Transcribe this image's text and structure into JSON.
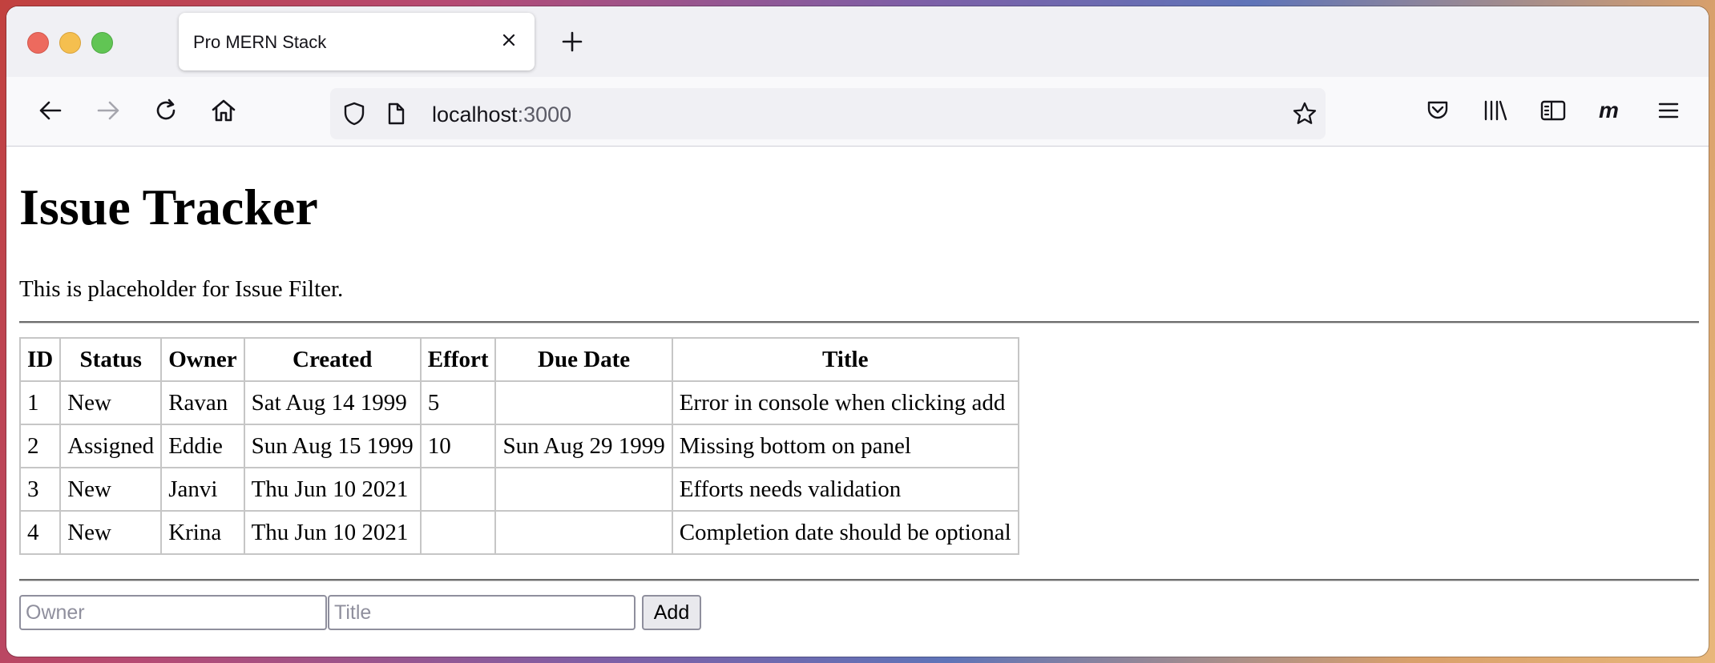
{
  "browser": {
    "tab_title": "Pro MERN Stack",
    "url_host": "localhost",
    "url_port": ":3000"
  },
  "page": {
    "title": "Issue Tracker",
    "filter_placeholder_text": "This is placeholder for Issue Filter.",
    "table": {
      "headers": [
        "ID",
        "Status",
        "Owner",
        "Created",
        "Effort",
        "Due Date",
        "Title"
      ],
      "rows": [
        [
          "1",
          "New",
          "Ravan",
          "Sat Aug 14 1999",
          "5",
          "",
          "Error in console when clicking add"
        ],
        [
          "2",
          "Assigned",
          "Eddie",
          "Sun Aug 15 1999",
          "10",
          "Sun Aug 29 1999",
          "Missing bottom on panel"
        ],
        [
          "3",
          "New",
          "Janvi",
          "Thu Jun 10 2021",
          "",
          "",
          "Efforts needs validation"
        ],
        [
          "4",
          "New",
          "Krina",
          "Thu Jun 10 2021",
          "",
          "",
          "Completion date should be optional"
        ]
      ]
    },
    "add_form": {
      "owner_placeholder": "Owner",
      "title_placeholder": "Title",
      "add_label": "Add"
    }
  },
  "icons": [
    "close-icon",
    "plus-icon",
    "back-icon",
    "forward-icon",
    "reload-icon",
    "home-icon",
    "shield-icon",
    "page-icon",
    "star-icon",
    "pocket-icon",
    "library-icon",
    "sidebar-icon",
    "extension-m-icon",
    "menu-icon"
  ],
  "colors": {
    "window_controls": [
      "#ed6a5e",
      "#f5bf4f",
      "#61c554"
    ],
    "forward_disabled": "#a6a6ae"
  }
}
